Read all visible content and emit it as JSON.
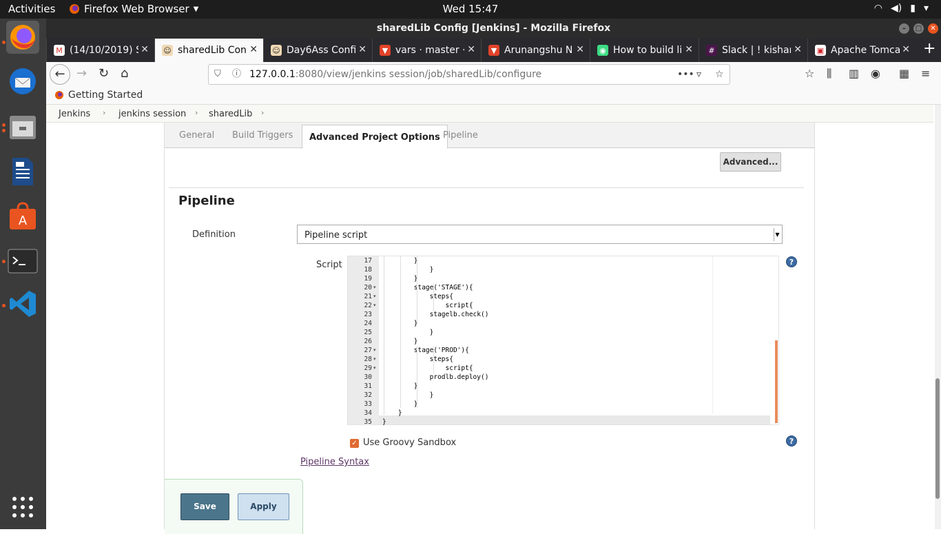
{
  "topbar": {
    "activities": "Activities",
    "app_menu": "Firefox Web Browser",
    "clock": "Wed 15:47"
  },
  "window": {
    "title": "sharedLib Config [Jenkins] - Mozilla Firefox"
  },
  "tabs": [
    {
      "label": "(14/10/2019) S",
      "icon": "gmail-icon"
    },
    {
      "label": "sharedLib Conf",
      "icon": "jenkins-icon"
    },
    {
      "label": "Day6Ass Confi",
      "icon": "jenkins-icon"
    },
    {
      "label": "vars · master ·",
      "icon": "gitlab-icon"
    },
    {
      "label": "Arunangshu Na",
      "icon": "gitlab-icon"
    },
    {
      "label": "How to build li",
      "icon": "android-icon"
    },
    {
      "label": "Slack | ! kishan",
      "icon": "slack-icon"
    },
    {
      "label": "Apache Tomca",
      "icon": "tomcat-icon"
    }
  ],
  "url": {
    "host": "127.0.0.1",
    "rest": ":8080/view/jenkins session/job/sharedLib/configure"
  },
  "bookmarks": {
    "getting_started": "Getting Started"
  },
  "breadcrumbs": [
    "Jenkins",
    "jenkins session",
    "sharedLib"
  ],
  "config_tabs": [
    "General",
    "Build Triggers",
    "Advanced Project Options",
    "Pipeline"
  ],
  "advanced_button": "Advanced...",
  "section_title": "Pipeline",
  "definition": {
    "label": "Definition",
    "value": "Pipeline script"
  },
  "script_label": "Script",
  "code_lines": [
    {
      "n": "17",
      "t": "        }"
    },
    {
      "n": "18",
      "t": "            }"
    },
    {
      "n": "19",
      "t": "        }"
    },
    {
      "n": "20",
      "t": "        stage('STAGE'){"
    },
    {
      "n": "21",
      "t": "            steps{"
    },
    {
      "n": "22",
      "t": "                script{"
    },
    {
      "n": "23",
      "t": "            stagelb.check()"
    },
    {
      "n": "24",
      "t": "        }"
    },
    {
      "n": "25",
      "t": "            }"
    },
    {
      "n": "26",
      "t": "        }"
    },
    {
      "n": "27",
      "t": "        stage('PROD'){"
    },
    {
      "n": "28",
      "t": "            steps{"
    },
    {
      "n": "29",
      "t": "                script{"
    },
    {
      "n": "30",
      "t": "            prodlb.deploy()"
    },
    {
      "n": "31",
      "t": "        }"
    },
    {
      "n": "32",
      "t": "            }"
    },
    {
      "n": "33",
      "t": "        }"
    },
    {
      "n": "34",
      "t": "    }"
    },
    {
      "n": "35",
      "t": "}"
    }
  ],
  "sandbox": {
    "label": "Use Groovy Sandbox",
    "checked": true
  },
  "pipeline_syntax": "Pipeline Syntax",
  "save": "Save",
  "apply": "Apply",
  "colors": {
    "dock": "#3b3b3b",
    "accent": "#e95420",
    "save": "#4b758b"
  }
}
